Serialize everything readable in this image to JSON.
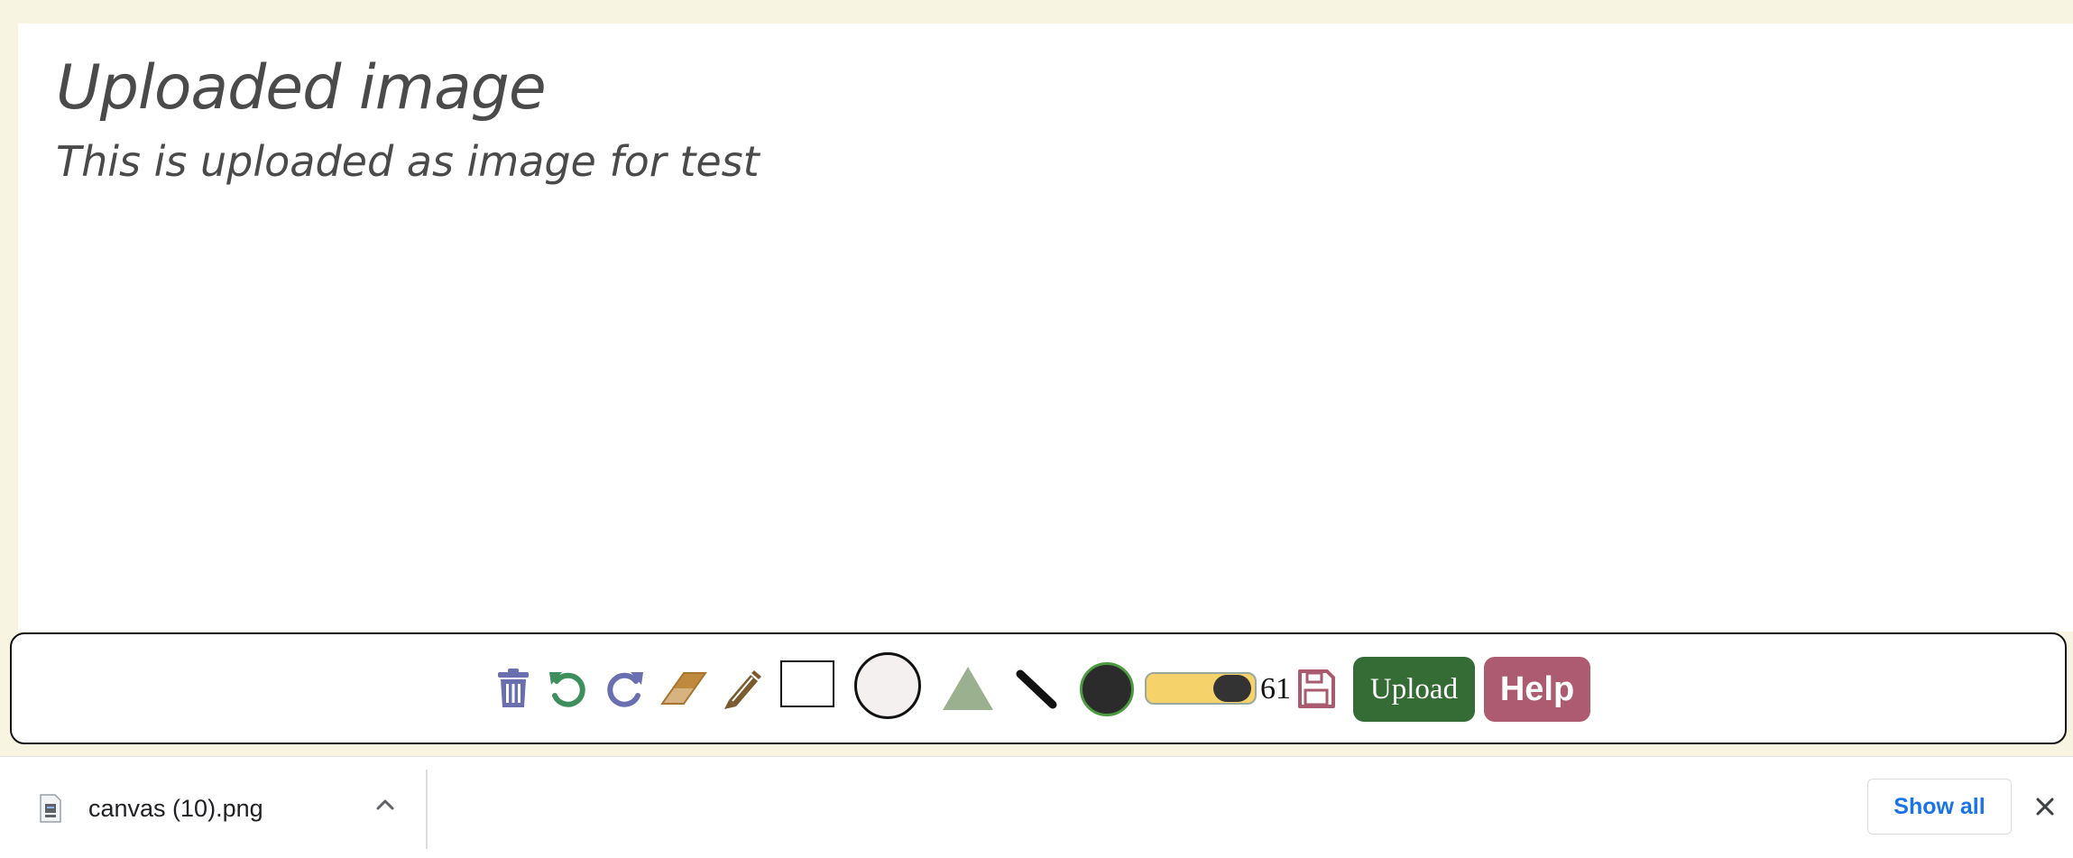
{
  "canvas": {
    "title": "Uploaded image",
    "subtitle": "This is uploaded as image for test"
  },
  "toolbar": {
    "tools": [
      {
        "name": "trash-icon",
        "color": "#6a6fb0"
      },
      {
        "name": "undo-icon",
        "color": "#3f8f5e"
      },
      {
        "name": "redo-icon",
        "color": "#6a6fb0"
      },
      {
        "name": "eraser-icon",
        "color": "#c08a3e"
      },
      {
        "name": "pencil-icon",
        "color": "#7a5a2e"
      },
      {
        "name": "rectangle-icon",
        "color": "#111111"
      },
      {
        "name": "circle-icon",
        "color": "#f3f0ef"
      },
      {
        "name": "triangle-icon",
        "color": "#9bb08e"
      },
      {
        "name": "line-icon",
        "color": "#111111"
      },
      {
        "name": "color-swatch-icon",
        "color": "#2b2b2b"
      },
      {
        "name": "save-icon",
        "color": "#a95a6e"
      }
    ],
    "size_slider": {
      "value": 61,
      "track_color": "#f6d36a",
      "knob_color": "#333333"
    },
    "size_value": "61",
    "upload_label": "Upload",
    "help_label": "Help",
    "upload_color": "#356b34",
    "help_color": "#ac5b71"
  },
  "downloads": {
    "file_name": "canvas (10).png",
    "show_all_label": "Show all",
    "icons": [
      "file-png-icon",
      "chevron-up-icon",
      "close-icon"
    ]
  }
}
